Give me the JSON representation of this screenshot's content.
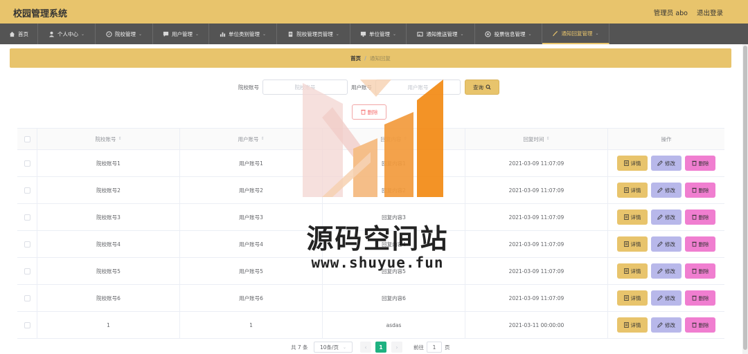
{
  "app": {
    "title": "校园管理系统",
    "user_label": "管理员 abo",
    "logout_label": "退出登录"
  },
  "nav": [
    {
      "label": "首页",
      "icon": "home-icon",
      "chevron": ""
    },
    {
      "label": "个人中心",
      "icon": "user-icon",
      "chevron": "⌄"
    },
    {
      "label": "院校管理",
      "icon": "compass-icon",
      "chevron": "⌄"
    },
    {
      "label": "用户管理",
      "icon": "chat-icon",
      "chevron": "⌄"
    },
    {
      "label": "单位类别管理",
      "icon": "bar-chart-icon",
      "chevron": "⌄"
    },
    {
      "label": "院校管理员管理",
      "icon": "document-icon",
      "chevron": "⌄"
    },
    {
      "label": "单位管理",
      "icon": "monitor-icon",
      "chevron": "⌄"
    },
    {
      "label": "通知推送管理",
      "icon": "image-icon",
      "chevron": "⌄"
    },
    {
      "label": "投票信息管理",
      "icon": "target-icon",
      "chevron": "⌄"
    },
    {
      "label": "通知回复管理",
      "icon": "brush-icon",
      "chevron": "⌄"
    }
  ],
  "breadcrumb": {
    "home": "首页",
    "separator": "/",
    "current": "通知回复"
  },
  "search": {
    "school_label": "院校账号",
    "school_placeholder": "院校账号",
    "user_label": "用户账号",
    "user_placeholder": "用户账号",
    "query_label": "查询"
  },
  "toolbar": {
    "delete_label": "删除"
  },
  "table": {
    "headers": [
      "院校账号",
      "用户账号",
      "回复内容",
      "回复时间",
      "操作"
    ],
    "sort_glyph": "⇕",
    "actions": {
      "detail": "详情",
      "edit": "修改",
      "remove": "删除"
    },
    "rows": [
      {
        "school": "院校账号1",
        "user": "用户账号1",
        "content": "回复内容1",
        "time": "2021-03-09 11:07:09"
      },
      {
        "school": "院校账号2",
        "user": "用户账号2",
        "content": "回复内容2",
        "time": "2021-03-09 11:07:09"
      },
      {
        "school": "院校账号3",
        "user": "用户账号3",
        "content": "回复内容3",
        "time": "2021-03-09 11:07:09"
      },
      {
        "school": "院校账号4",
        "user": "用户账号4",
        "content": "回复内容4",
        "time": "2021-03-09 11:07:09"
      },
      {
        "school": "院校账号5",
        "user": "用户账号5",
        "content": "回复内容5",
        "time": "2021-03-09 11:07:09"
      },
      {
        "school": "院校账号6",
        "user": "用户账号6",
        "content": "回复内容6",
        "time": "2021-03-09 11:07:09"
      },
      {
        "school": "1",
        "user": "1",
        "content": "asdas",
        "time": "2021-03-11 00:00:00"
      }
    ]
  },
  "pagination": {
    "total_label": "共 7 条",
    "page_size": "10条/页",
    "prev": "‹",
    "next": "›",
    "current_page": "1",
    "goto_label": "前往",
    "goto_value": "1",
    "page_unit": "页"
  },
  "watermark": {
    "text": "源码空间站",
    "url": "www.shuyue.fun"
  },
  "colors": {
    "accent": "#e8c46c",
    "nav_bg": "#545454",
    "edit": "#b8b8ea",
    "remove": "#f07ed0",
    "page_active": "#1eb281"
  }
}
